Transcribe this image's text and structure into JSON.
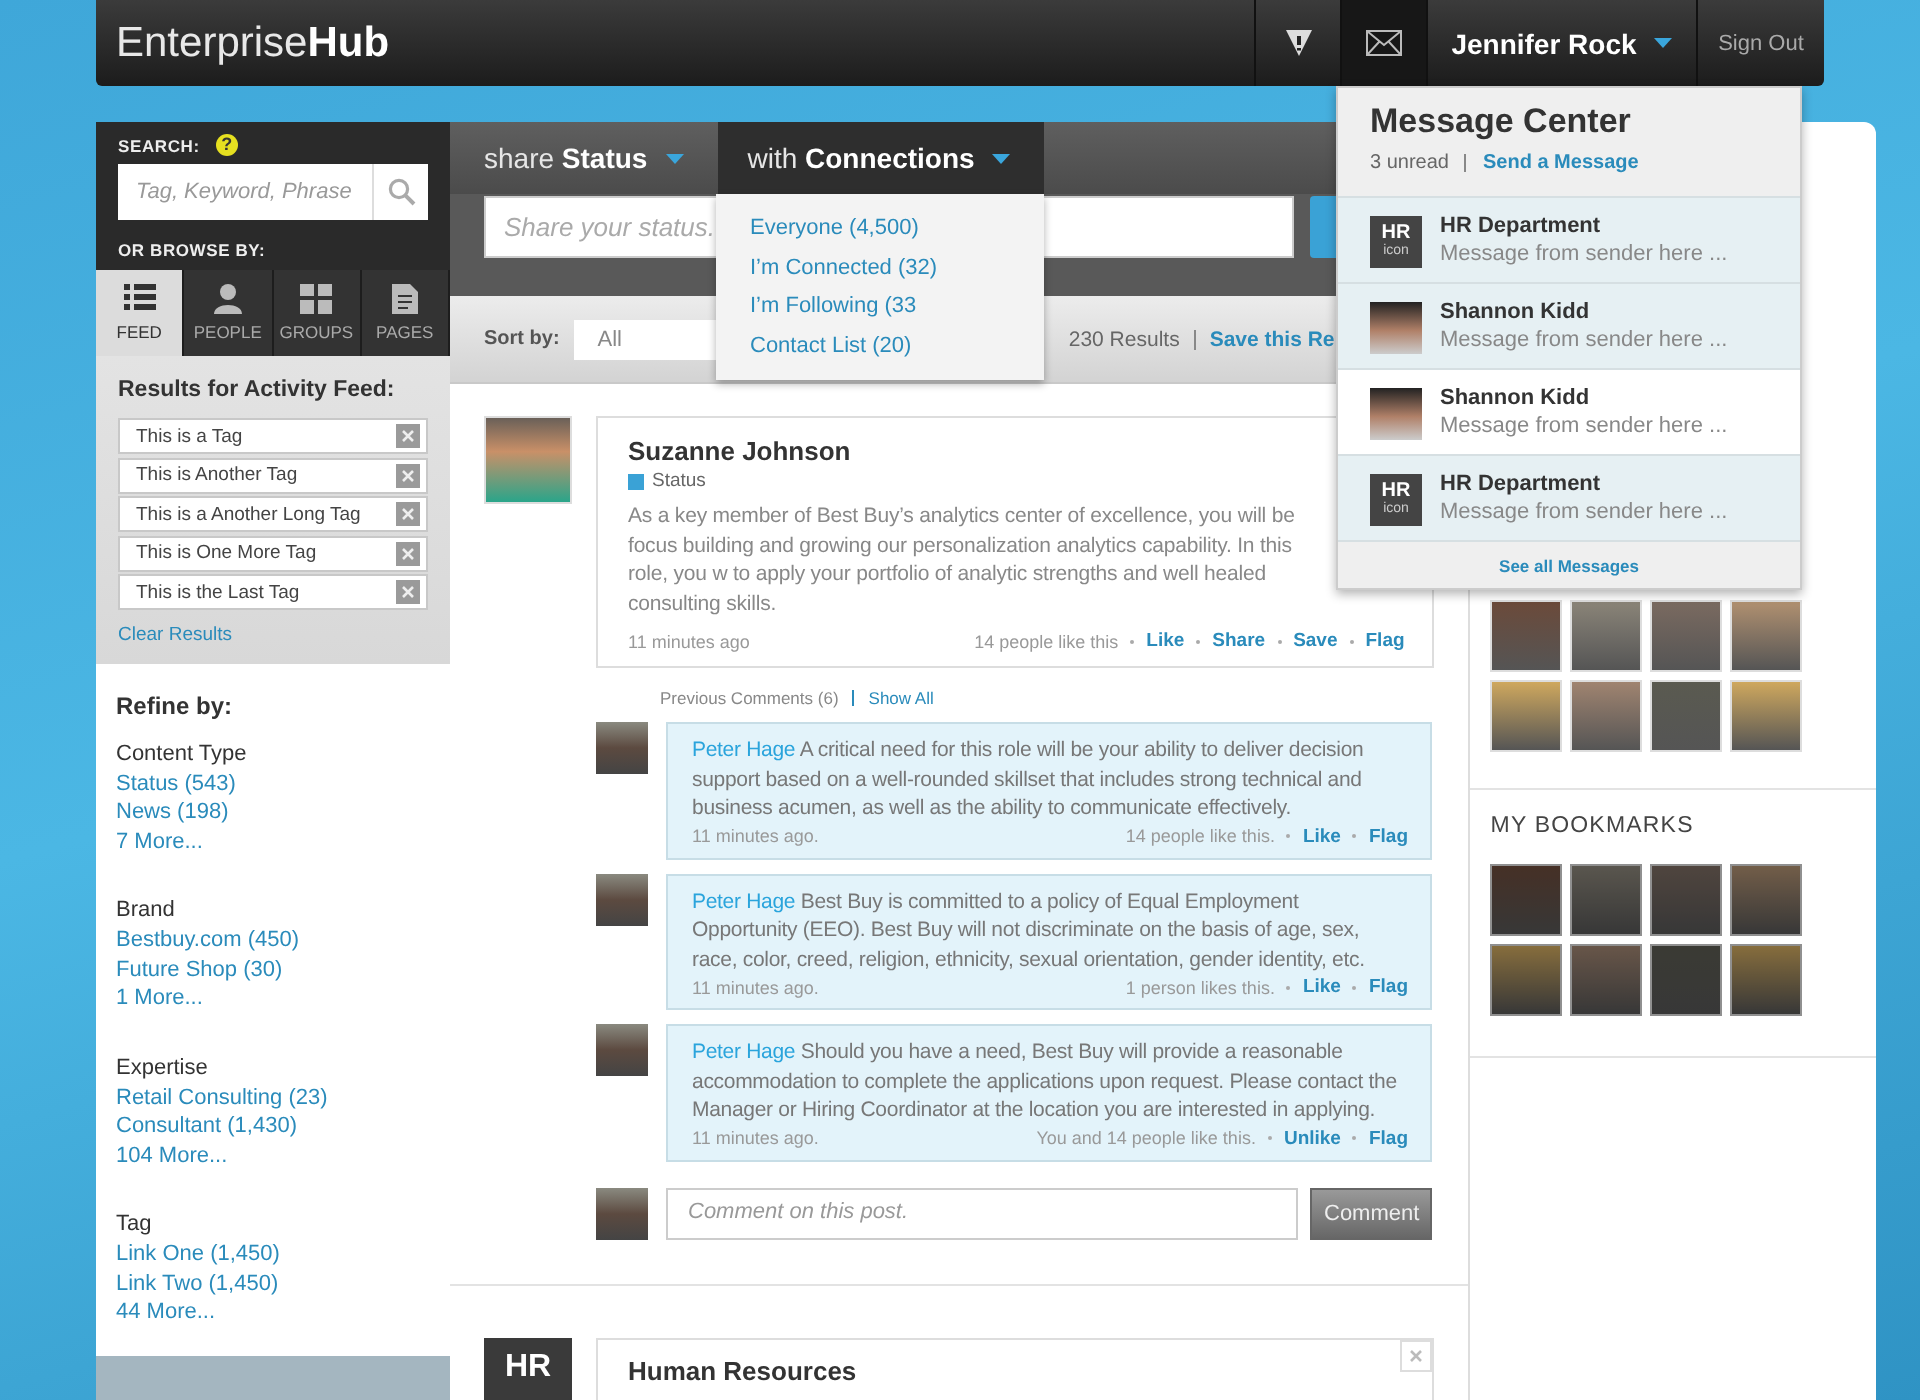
{
  "header": {
    "logo": "Enterprise**Hub**",
    "icons": [
      {
        "kind": "alert",
        "selected": false
      },
      {
        "kind": "mail",
        "selected": true
      }
    ],
    "user": "Jennifer Rock",
    "sign_out": "Sign Out"
  },
  "sidebar": {
    "search_label": "SEARCH:",
    "help": "?",
    "search_placeholder": "Tag, Keyword, Phrase",
    "browse_label": "OR BROWSE BY:",
    "browse_tabs": [
      {
        "kind": "feed",
        "label": "FEED",
        "selected": true
      },
      {
        "kind": "people",
        "label": "PEOPLE",
        "selected": false
      },
      {
        "kind": "groups",
        "label": "GROUPS",
        "selected": false
      },
      {
        "kind": "pages",
        "label": "PAGES",
        "selected": false
      }
    ],
    "results_heading": "Results for Activity Feed:",
    "tags": [
      "This is a Tag",
      "This is Another Tag",
      "This is a Another Long Tag",
      "This is One More Tag",
      "This is the Last Tag"
    ],
    "clear_link": "Clear Results",
    "refine_heading": "Refine by:",
    "refine_groups": [
      {
        "heading": "Content Type",
        "links": [
          "Status (543)",
          "News (198)",
          "7 More..."
        ]
      },
      {
        "heading": "Brand",
        "links": [
          "Bestbuy.com (450)",
          "Future Shop (30)",
          "1 More..."
        ]
      },
      {
        "heading": "Expertise",
        "links": [
          "Retail Consulting (23)",
          "Consultant (1,430)",
          "104 More..."
        ]
      },
      {
        "heading": "Tag",
        "links": [
          "Link One (1,450)",
          "Link Two (1,450)",
          "44 More..."
        ]
      }
    ]
  },
  "composer": {
    "tabs": [
      {
        "label": "share **Status**",
        "selected": false
      },
      {
        "label": "with **Connections**",
        "selected": true
      }
    ],
    "placeholder": "Share your status.",
    "audience_options": [
      "Everyone (4,500)",
      "I’m Connected (32)",
      "I’m Following (33",
      "Contact List (20)"
    ]
  },
  "sort_bar": {
    "label": "Sort by:",
    "value": "All",
    "results": "230 Results",
    "save_link": "Save this Re"
  },
  "post": {
    "author": "Suzanne Johnson",
    "type": "Status",
    "body": "As a key member of Best Buy’s analytics center of excellence, you will be focus building and growing our personalization analytics capability. In this role, you w to apply your portfolio of analytic strengths and well healed consulting skills.",
    "time": "11 minutes ago",
    "likes": "14 people like this",
    "actions": [
      "Like",
      "Share",
      "Save",
      "Flag"
    ],
    "previous_comments": "Previous Comments (6)",
    "show_all": "Show All",
    "comments": [
      {
        "author": "Peter Hage",
        "text": "A critical need for this role will be your ability to deliver decision support based on a well-rounded skillset that includes strong technical and business acumen, as well as the ability to communicate effectively.",
        "time": "11 minutes ago.",
        "likes": "14 people like this.",
        "actions": [
          "Like",
          "Flag"
        ]
      },
      {
        "author": "Peter Hage",
        "text": "Best Buy is committed to a policy of Equal Employment Opportunity (EEO). Best Buy will not discriminate on the basis of age, sex, race, color, creed, religion, ethnicity, sexual orientation, gender identity, etc.",
        "time": "11 minutes ago.",
        "likes": "1 person likes this.",
        "actions": [
          "Like",
          "Flag"
        ]
      },
      {
        "author": "Peter Hage",
        "text": "Should you have a need, Best Buy will provide a reasonable accommodation to complete the applications upon request. Please contact the Manager or Hiring Coordinator at the location you are interested in applying.",
        "time": "11 minutes ago.",
        "likes": "You and 14 people like this.",
        "actions": [
          "Unlike",
          "Flag"
        ]
      }
    ],
    "comment_placeholder": "Comment on this post.",
    "comment_button": "Comment"
  },
  "next_post": {
    "avatar": "HR",
    "title": "Human Resources"
  },
  "message_center": {
    "title": "Message Center",
    "unread": "3 unread",
    "send_link": "Send a Message",
    "messages": [
      {
        "avatar": {
          "kind": "label",
          "text": "HR",
          "caption": "icon"
        },
        "sender": "HR Department",
        "preview": "Message from sender here ...",
        "unread": true
      },
      {
        "avatar": {
          "kind": "photo"
        },
        "sender": "Shannon Kidd",
        "preview": "Message from sender here ...",
        "unread": true
      },
      {
        "avatar": {
          "kind": "photo"
        },
        "sender": "Shannon Kidd",
        "preview": "Message from sender here ...",
        "unread": false
      },
      {
        "avatar": {
          "kind": "label",
          "text": "HR",
          "caption": "icon"
        },
        "sender": "HR Department",
        "preview": "Message from sender here ...",
        "unread": true
      }
    ],
    "see_all": "See all Messages"
  },
  "right_column": {
    "bookmarks_heading": "MY BOOKMARKS"
  }
}
